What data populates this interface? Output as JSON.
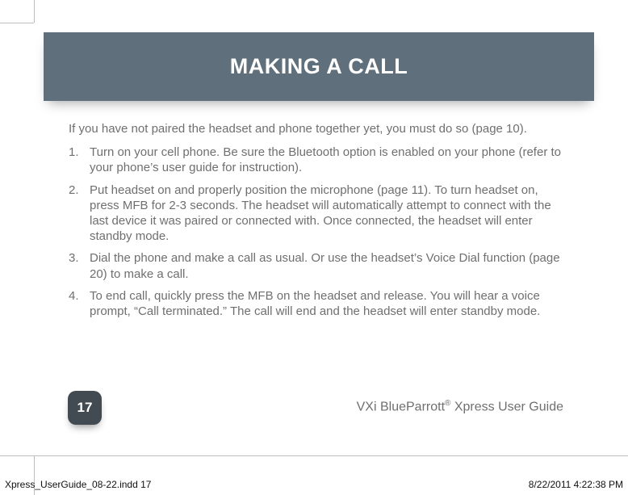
{
  "header": {
    "title": "MAKING A CALL"
  },
  "body": {
    "intro": "If you have not paired the headset and phone together yet, you must do so (page 10).",
    "steps": [
      {
        "num": "1.",
        "text": "Turn on your cell phone. Be sure the Bluetooth option is enabled on your phone (refer to your phone’s user guide for instruction)."
      },
      {
        "num": "2.",
        "text": "Put headset on and properly position the microphone (page 11). To turn headset on, press MFB for 2-3 seconds. The headset will automatically attempt to connect with the last device it was paired or connected with. Once connected, the headset will enter standby mode."
      },
      {
        "num": "3.",
        "text": "Dial the phone and make a call as usual. Or use the headset’s Voice Dial function (page 20) to make a call."
      },
      {
        "num": "4.",
        "text": "To end call, quickly press the MFB on the headset and release. You will hear a voice prompt, “Call terminated.” The call will end and the headset will enter standby mode."
      }
    ]
  },
  "footer": {
    "page_number": "17",
    "guide_prefix": "VXi BlueParrott",
    "guide_reg": "®",
    "guide_suffix": " Xpress User Guide"
  },
  "slug": {
    "file": "Xpress_UserGuide_08-22.indd   17",
    "timestamp": "8/22/2011   4:22:38 PM"
  }
}
